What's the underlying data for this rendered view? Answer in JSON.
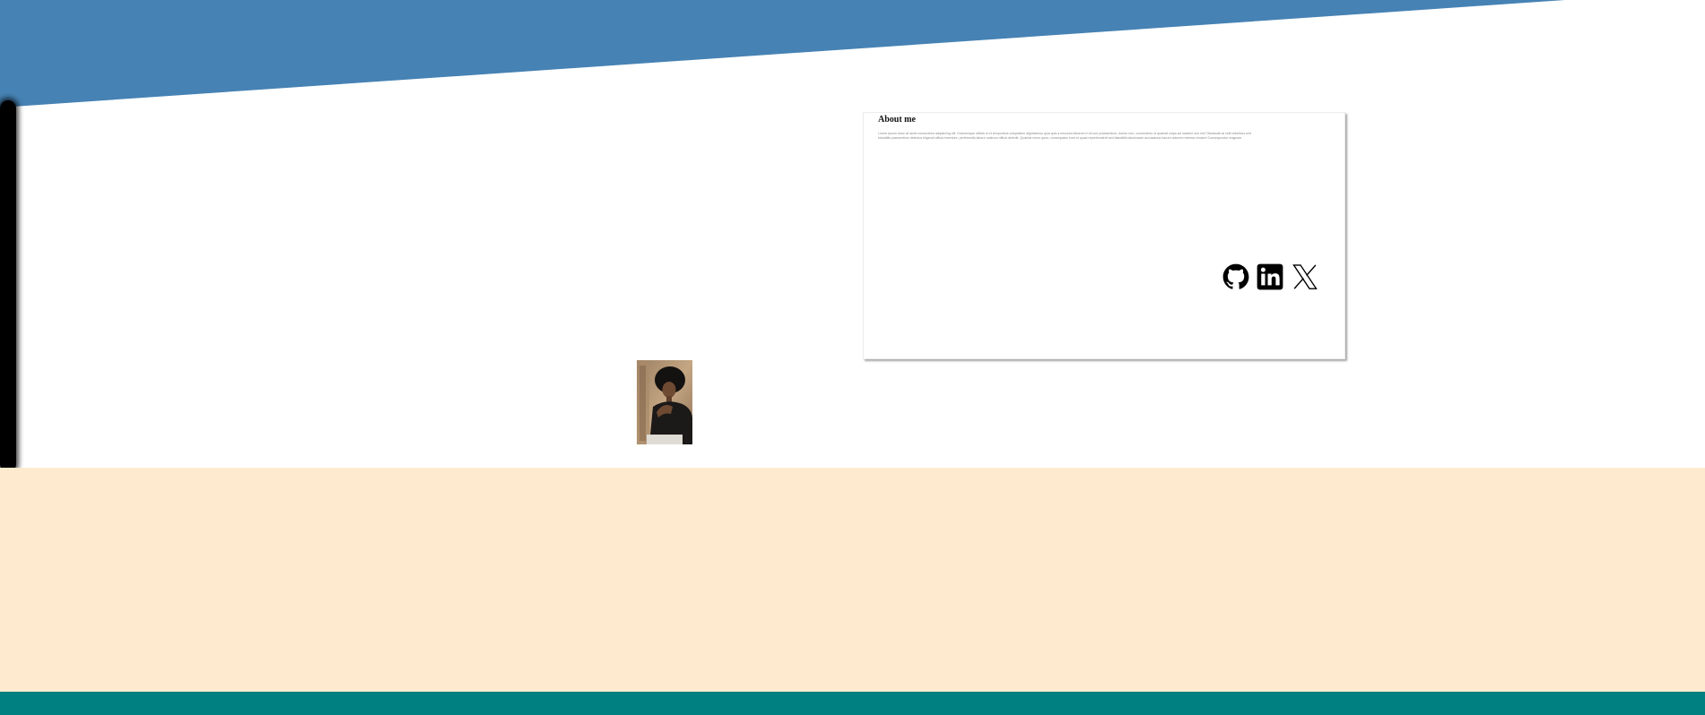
{
  "colors": {
    "hero": "#4682b4",
    "cream": "#feebcf",
    "footer": "#008080",
    "card_text": "#8a8a8a",
    "icon": "#000000"
  },
  "about": {
    "title": "About me",
    "text": "Lorem ipsum dolor sit amet consectetur adipisicing elit. Doloremque officiis et et temporibus voluptatem dignissimos quia quis a nesciunt laborum in et iure praesentium, dolore rem, consectetur ut quaerat culpa ad maxime eos est! Obcaecati at velit doloribus sed blanditiis praesentium delectus eligendi officia inventore, perferendis labore nostrum officia deleniti. Quaerat nemo quos, consequatur eum et quasi reprehenderit sed blanditiis laboriosam accusamus harum dolorem minima veniam! Consequuntur magnam."
  },
  "social": [
    {
      "name": "github",
      "icon": "github-icon"
    },
    {
      "name": "linkedin",
      "icon": "linkedin-icon"
    },
    {
      "name": "x",
      "icon": "x-icon"
    }
  ],
  "portrait": {
    "icon": "portrait-photo"
  }
}
